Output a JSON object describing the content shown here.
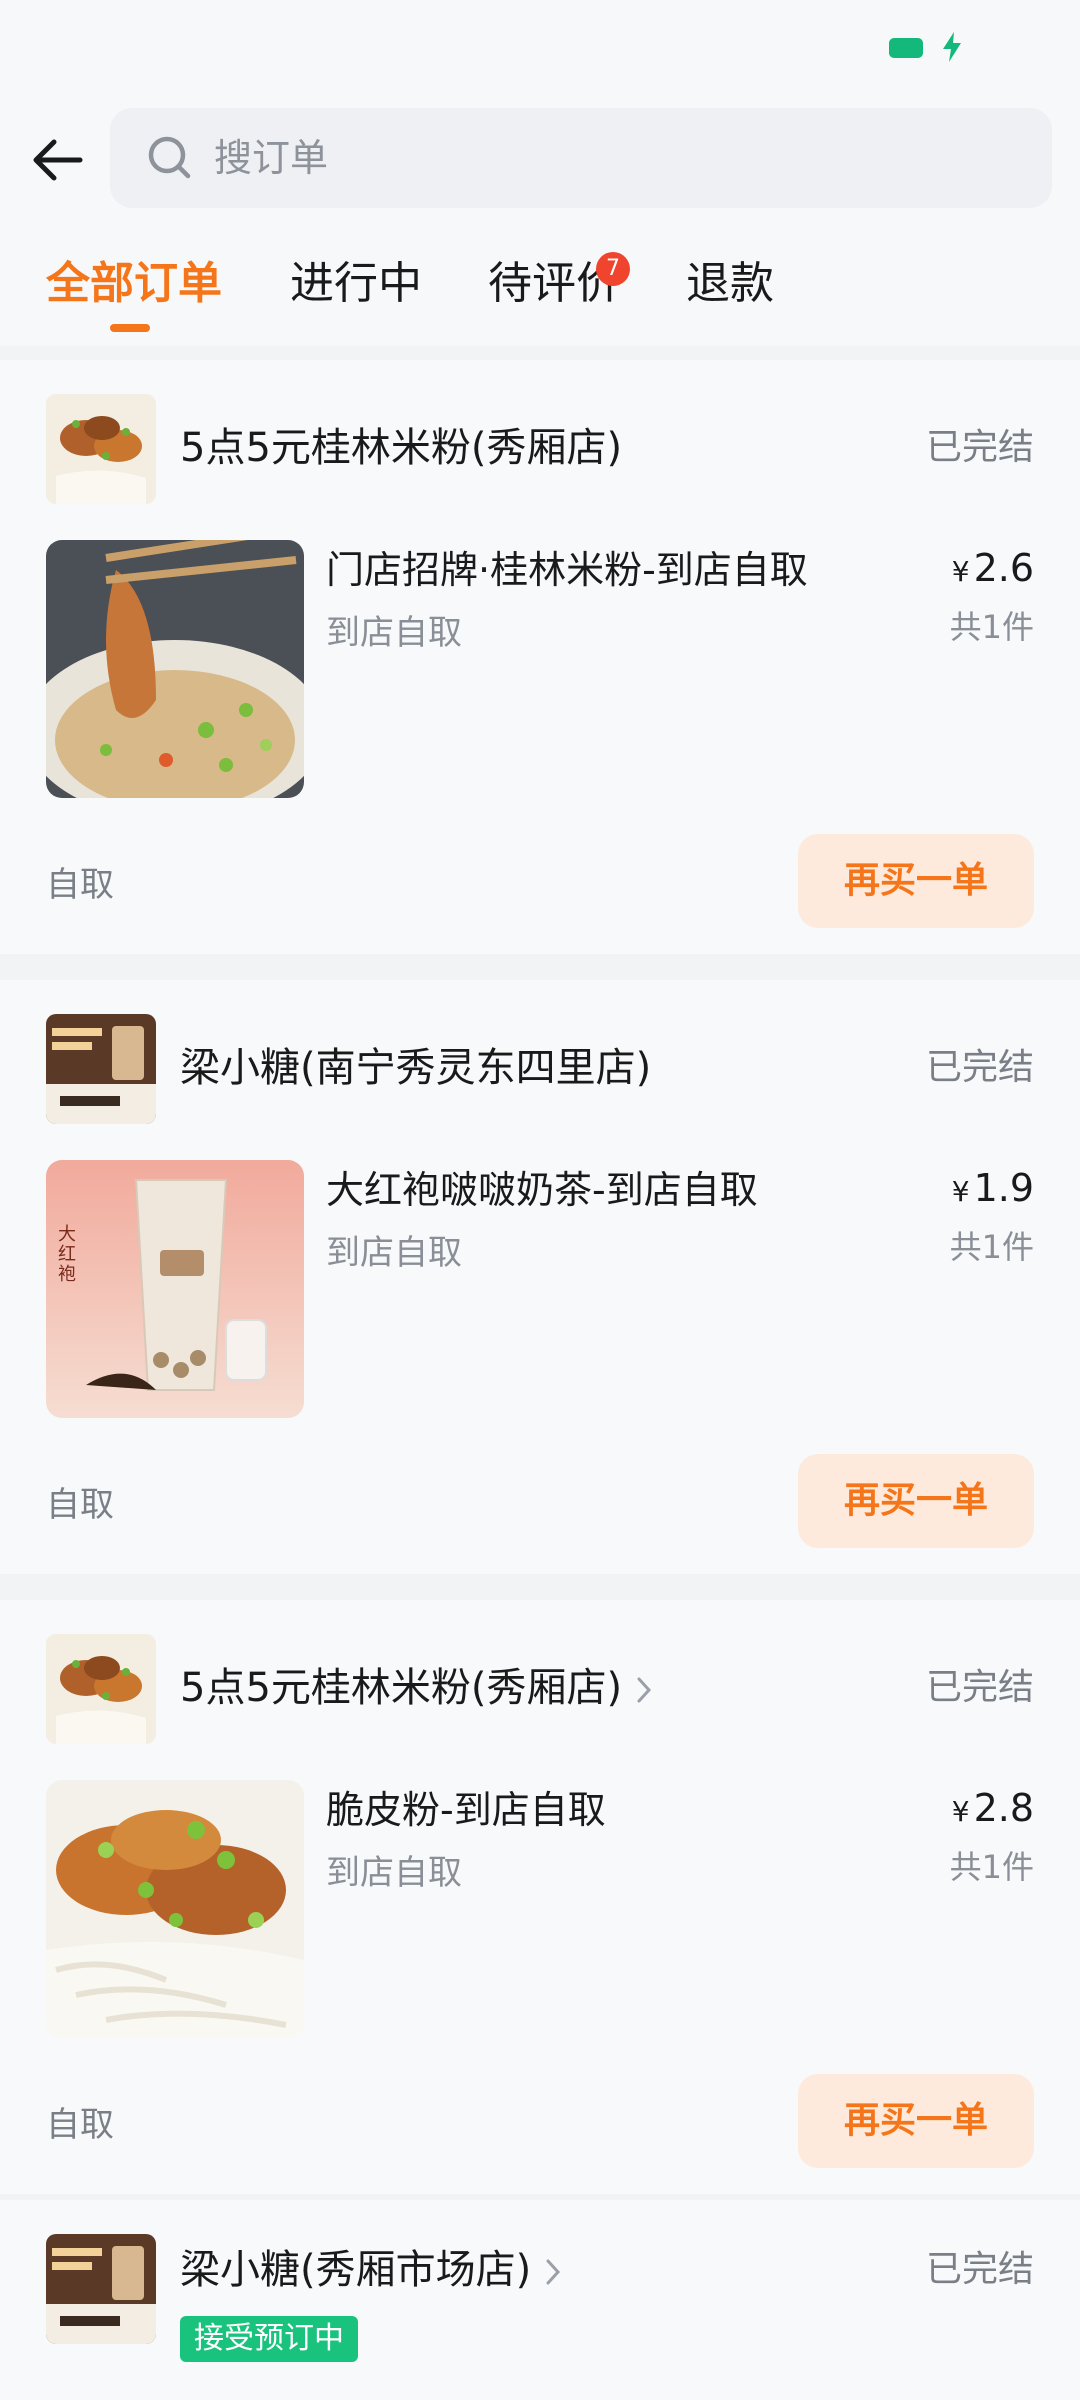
{
  "search": {
    "placeholder": "搜订单"
  },
  "tabs": [
    {
      "label": "全部订单"
    },
    {
      "label": "进行中"
    },
    {
      "label": "待评价",
      "badge": "7"
    },
    {
      "label": "退款"
    }
  ],
  "orders": [
    {
      "store": "5点5元桂林米粉(秀厢店)",
      "status": "已完结",
      "item_name": "门店招牌·桂林米粉-到店自取",
      "item_sub": "到店自取",
      "currency": "¥",
      "price": "2.6",
      "qty": "共1件",
      "method": "自取",
      "rebuy": "再买一单"
    },
    {
      "store": "梁小糖(南宁秀灵东四里店)",
      "status": "已完结",
      "item_name": "大红袍啵啵奶茶-到店自取",
      "item_sub": "到店自取",
      "currency": "¥",
      "price": "1.9",
      "qty": "共1件",
      "method": "自取",
      "rebuy": "再买一单"
    },
    {
      "store": "5点5元桂林米粉(秀厢店)",
      "status": "已完结",
      "item_name": "脆皮粉-到店自取",
      "item_sub": "到店自取",
      "currency": "¥",
      "price": "2.8",
      "qty": "共1件",
      "method": "自取",
      "rebuy": "再买一单"
    },
    {
      "store": "梁小糖(秀厢市场店)",
      "status": "已完结",
      "tag": "接受预订中"
    }
  ],
  "colors": {
    "accent": "#f5761a",
    "badge": "#f0442e",
    "tag": "#19c37d",
    "battery": "#14b87a"
  }
}
